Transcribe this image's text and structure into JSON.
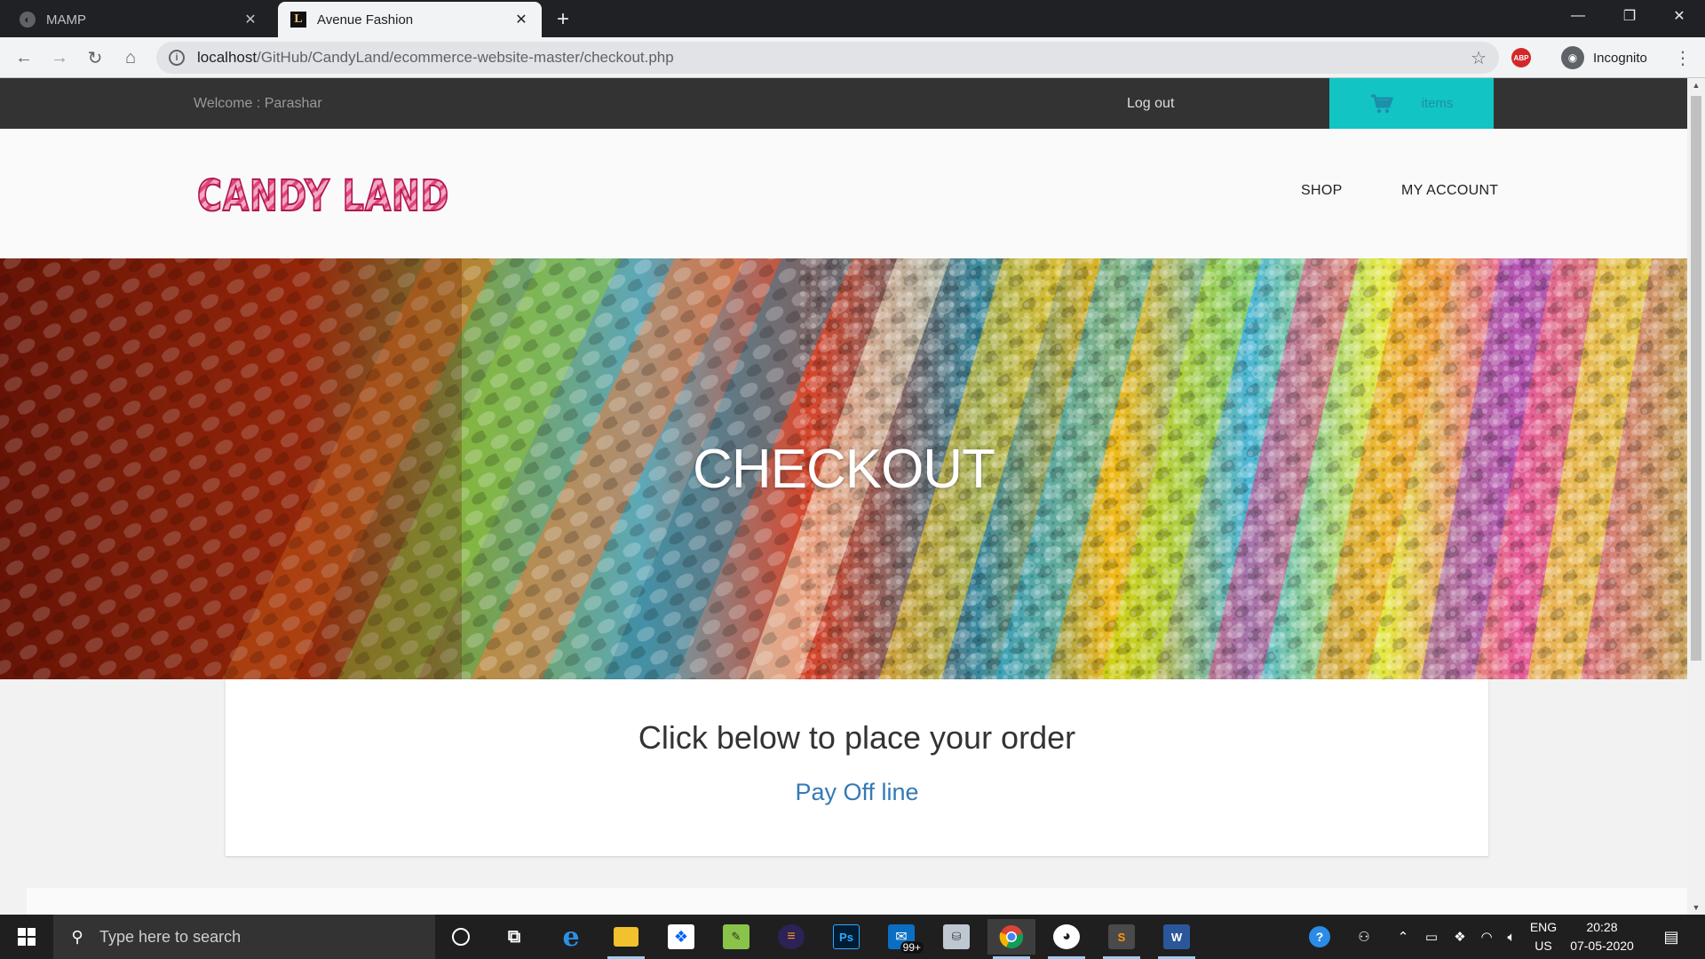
{
  "browser": {
    "tabs": [
      {
        "title": "MAMP",
        "favicon": "mamp-favicon",
        "active": false
      },
      {
        "title": "Avenue Fashion",
        "favicon": "L",
        "active": true
      }
    ],
    "url_prefix": "localhost",
    "url_path": "/GitHub/CandyLand/ecommerce-website-master/checkout.php",
    "profile_label": "Incognito",
    "extension_label": "ABP"
  },
  "site": {
    "welcome_text": "Welcome : Parashar",
    "logout_label": "Log out",
    "cart_label": "items",
    "logo_text": "CANDY LAND",
    "nav": {
      "shop": "SHOP",
      "account": "MY ACCOUNT"
    },
    "hero_title": "CHECKOUT",
    "order_heading": "Click below to place your order",
    "pay_link": "Pay Off line",
    "accent_color": "#12c4c4",
    "link_color": "#337ab7"
  },
  "taskbar": {
    "search_placeholder": "Type here to search",
    "mail_badge": "99+",
    "language": {
      "line1": "ENG",
      "line2": "US"
    },
    "clock": {
      "time": "20:28",
      "date": "07-05-2020"
    }
  }
}
